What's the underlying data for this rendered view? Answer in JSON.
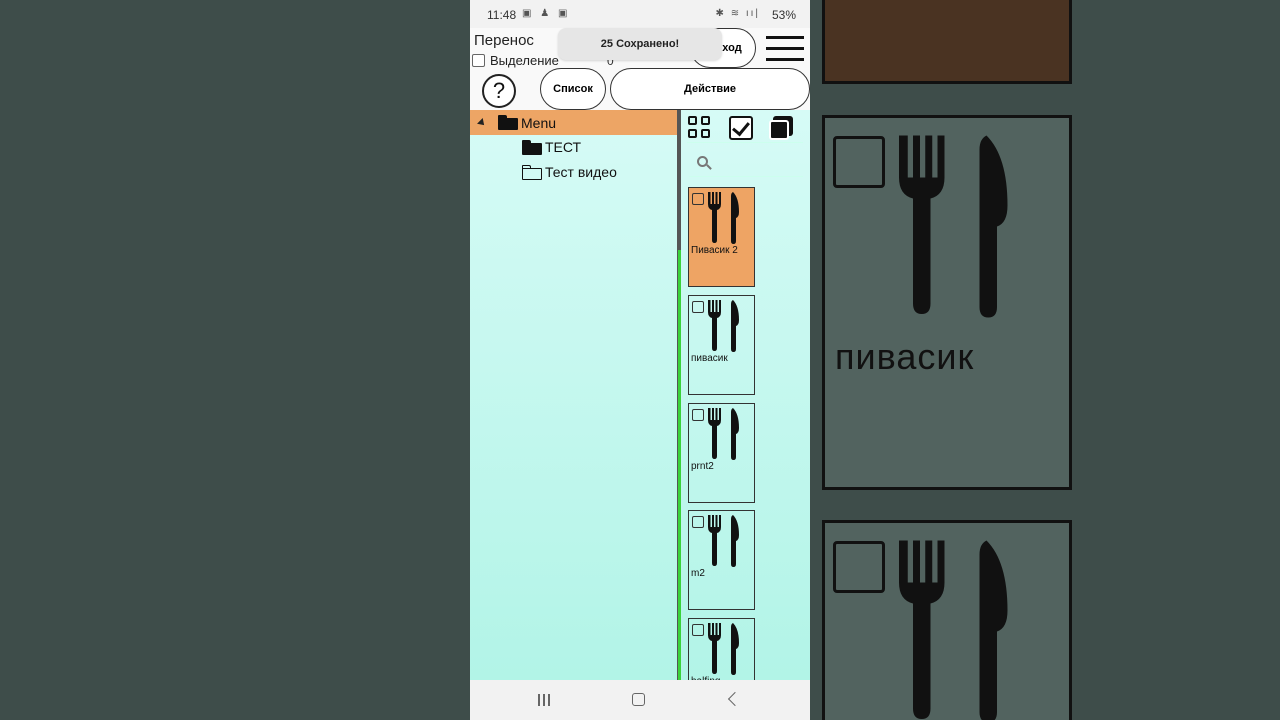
{
  "status_bar": {
    "time": "11:48",
    "battery": "53%"
  },
  "top": {
    "move_label": "Перенос",
    "selection_label": "Выделение",
    "selection_count": "0",
    "toast": "25 Сохранено!",
    "exit_button": "ход",
    "help_button": "?",
    "list_button": "Список",
    "action_button": "Действие"
  },
  "tree": {
    "root": "Menu",
    "items": [
      "ТЕСТ",
      "Тест видео"
    ]
  },
  "cards": [
    {
      "label": "Пивасик 2",
      "active": true
    },
    {
      "label": "пивасик",
      "active": false
    },
    {
      "label": "prnt2",
      "active": false
    },
    {
      "label": "m2",
      "active": false
    },
    {
      "label": "halfing",
      "active": false
    }
  ],
  "background_card_text": "пивасик",
  "colors": {
    "selected": "#eea464",
    "panel": "#b8f4ea",
    "scroll_indicator": "#3ad23a"
  }
}
